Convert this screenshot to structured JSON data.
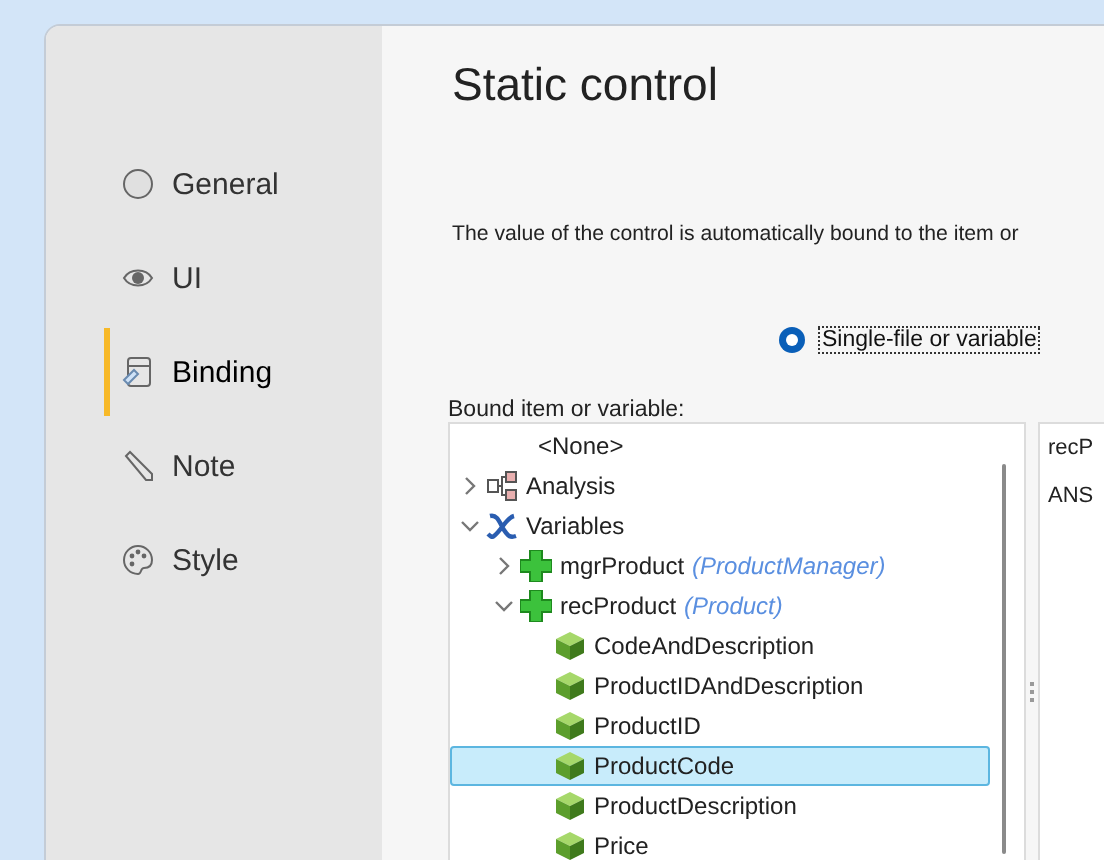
{
  "window": {
    "title": "Static control"
  },
  "sidebar": {
    "items": [
      {
        "label": "General",
        "selected": false
      },
      {
        "label": "UI",
        "selected": false
      },
      {
        "label": "Binding",
        "selected": true
      },
      {
        "label": "Note",
        "selected": false
      },
      {
        "label": "Style",
        "selected": false
      }
    ]
  },
  "description": "The value of the control is automatically bound to the item or",
  "binding_mode": {
    "label": "Single-file or variable",
    "selected": true
  },
  "tree": {
    "label": "Bound item or variable:",
    "items": [
      {
        "label": "<None>",
        "kind": "none",
        "selected": false
      },
      {
        "label": "Analysis",
        "kind": "analysis",
        "expanded": false,
        "selected": false
      },
      {
        "label": "Variables",
        "kind": "variables",
        "expanded": true,
        "selected": false,
        "children": [
          {
            "label": "mgrProduct",
            "type": "(ProductManager)",
            "kind": "class",
            "expanded": false,
            "selected": false
          },
          {
            "label": "recProduct",
            "type": "(Product)",
            "kind": "class",
            "expanded": true,
            "selected": false,
            "children": [
              {
                "label": "CodeAndDescription",
                "kind": "member",
                "selected": false
              },
              {
                "label": "ProductIDAndDescription",
                "kind": "member",
                "selected": false
              },
              {
                "label": "ProductID",
                "kind": "member",
                "selected": false
              },
              {
                "label": "ProductCode",
                "kind": "member",
                "selected": true
              },
              {
                "label": "ProductDescription",
                "kind": "member",
                "selected": false
              },
              {
                "label": "Price",
                "kind": "member",
                "selected": false
              }
            ]
          }
        ]
      }
    ]
  },
  "details": {
    "lines": [
      "recP",
      "ANS"
    ]
  }
}
